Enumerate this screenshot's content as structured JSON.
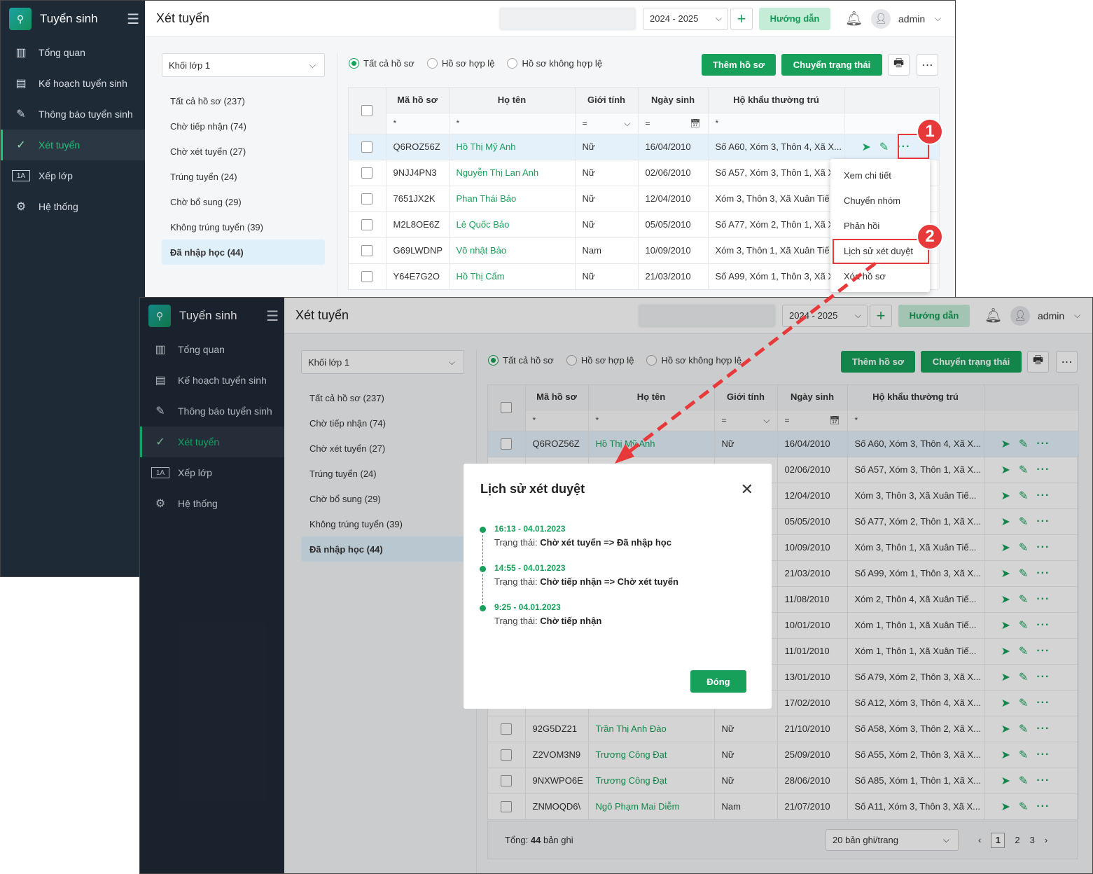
{
  "app": {
    "brand": "Tuyển sinh",
    "page_title": "Xét tuyển",
    "year": "2024 - 2025",
    "guide": "Hướng dẫn",
    "user": "admin"
  },
  "nav": [
    {
      "label": "Tổng quan",
      "icon": "chart-icon"
    },
    {
      "label": "Kế hoạch tuyển sinh",
      "icon": "document-icon"
    },
    {
      "label": "Thông báo tuyển sinh",
      "icon": "edit-icon"
    },
    {
      "label": "Xét tuyển",
      "icon": "check-circle-icon"
    },
    {
      "label": "Xếp lớp",
      "icon": "class-icon"
    },
    {
      "label": "Hệ thống",
      "icon": "gear-icon"
    }
  ],
  "grade_select": "Khối lớp 1",
  "categories": [
    "Tất cả hồ sơ (237)",
    "Chờ tiếp nhận (74)",
    "Chờ xét tuyển (27)",
    "Trúng tuyển (24)",
    "Chờ bổ sung (29)",
    "Không trúng tuyển (39)",
    "Đã nhập học (44)"
  ],
  "filters": [
    "Tất cả hồ sơ",
    "Hồ sơ hợp lệ",
    "Hồ sơ không hợp lệ"
  ],
  "buttons": {
    "add": "Thêm hồ sơ",
    "change_status": "Chuyển trạng thái"
  },
  "columns": [
    "Mã hồ sơ",
    "Họ tên",
    "Giới tính",
    "Ngày sinh",
    "Hộ khẩu thường trú"
  ],
  "filter_row": {
    "star": "*",
    "eq": "="
  },
  "rows_top": [
    [
      "Q6ROZ56Z",
      "Hồ Thị Mỹ Anh",
      "Nữ",
      "16/04/2010",
      "Số A60, Xóm 3, Thôn 4, Xã X..."
    ],
    [
      "9NJJ4PN3",
      "Nguyễn Thị Lan Anh",
      "Nữ",
      "02/06/2010",
      "Số A57, Xóm 3, Thôn 1, Xã X"
    ],
    [
      "7651JX2K",
      "Phan Thái Bảo",
      "Nữ",
      "12/04/2010",
      "Xóm 3, Thôn 3, Xã Xuân Tiế"
    ],
    [
      "M2L8OE6Z",
      "Lê Quốc Bảo",
      "Nữ",
      "05/05/2010",
      "Số A77, Xóm 2, Thôn 1, Xã X"
    ],
    [
      "G69LWDNP",
      "Võ nhật Bảo",
      "Nam",
      "10/09/2010",
      "Xóm 3, Thôn 1, Xã Xuân Tiế"
    ],
    [
      "Y64E7G2O",
      "Hồ Thị Cẩm",
      "Nữ",
      "21/03/2010",
      "Số A99, Xóm 1, Thôn 3, Xã X"
    ]
  ],
  "context_menu": [
    "Xem chi tiết",
    "Chuyển nhóm",
    "Phản hồi",
    "Lịch sử xét duyệt",
    "Xóa hồ sơ"
  ],
  "steps": [
    "1",
    "2"
  ],
  "rows_bottom": [
    [
      "Q6ROZ56Z",
      "Hồ Thị Mỹ Anh",
      "Nữ",
      "16/04/2010",
      "Số A60, Xóm 3, Thôn 4, Xã X..."
    ],
    [
      "",
      "",
      "",
      "02/06/2010",
      "Số A57, Xóm 3, Thôn 1, Xã X..."
    ],
    [
      "",
      "",
      "",
      "12/04/2010",
      "Xóm 3, Thôn 3, Xã Xuân Tiế..."
    ],
    [
      "",
      "",
      "",
      "05/05/2010",
      "Số A77, Xóm 2, Thôn 1, Xã X..."
    ],
    [
      "",
      "",
      "",
      "10/09/2010",
      "Xóm 3, Thôn 1, Xã Xuân Tiế..."
    ],
    [
      "",
      "",
      "",
      "21/03/2010",
      "Số A99, Xóm 1, Thôn 3, Xã X..."
    ],
    [
      "",
      "",
      "",
      "11/08/2010",
      "Xóm 2, Thôn 4, Xã Xuân Tiế..."
    ],
    [
      "",
      "",
      "",
      "10/01/2010",
      "Xóm 1, Thôn 1, Xã Xuân Tiế..."
    ],
    [
      "",
      "",
      "",
      "11/01/2010",
      "Xóm 1, Thôn 1, Xã Xuân Tiế..."
    ],
    [
      "",
      "",
      "",
      "13/01/2010",
      "Số A79, Xóm 2, Thôn 3, Xã X..."
    ],
    [
      "",
      "",
      "",
      "17/02/2010",
      "Số A12, Xóm 3, Thôn 4, Xã X..."
    ],
    [
      "92G5DZ21",
      "Trần Thị Anh Đào",
      "Nữ",
      "21/10/2010",
      "Số A58, Xóm 3, Thôn 2, Xã X..."
    ],
    [
      "Z2VOM3N9",
      "Trương Công Đạt",
      "Nữ",
      "25/09/2010",
      "Số A55, Xóm 2, Thôn 3, Xã X..."
    ],
    [
      "9NXWPO6E",
      "Trương Công Đạt",
      "Nữ",
      "28/06/2010",
      "Số A85, Xóm 1, Thôn 1, Xã X..."
    ],
    [
      "ZNMOQD6\\",
      "Ngô Phạm Mai Diễm",
      "Nam",
      "21/07/2010",
      "Số A11, Xóm 3, Thôn 3, Xã X..."
    ]
  ],
  "dialog": {
    "title": "Lịch sử xét duyệt",
    "status_label": "Trạng thái:",
    "close_button": "Đóng",
    "history": [
      {
        "time": "16:13 - 04.01.2023",
        "status": "Chờ xét tuyển => Đã nhập học"
      },
      {
        "time": "14:55 - 04.01.2023",
        "status": "Chờ tiếp nhận => Chờ xét tuyển"
      },
      {
        "time": "9:25 - 04.01.2023",
        "status": "Chờ tiếp nhận"
      }
    ]
  },
  "footer": {
    "total_prefix": "Tổng:",
    "total_count": "44",
    "total_suffix": "bản ghi",
    "page_size": "20 bản ghi/trang",
    "pages": [
      "1",
      "2",
      "3"
    ],
    "current_page": "1"
  },
  "colors": {
    "green": "#17a05a",
    "sidebar": "#1f2a37",
    "red": "#e8393a"
  }
}
